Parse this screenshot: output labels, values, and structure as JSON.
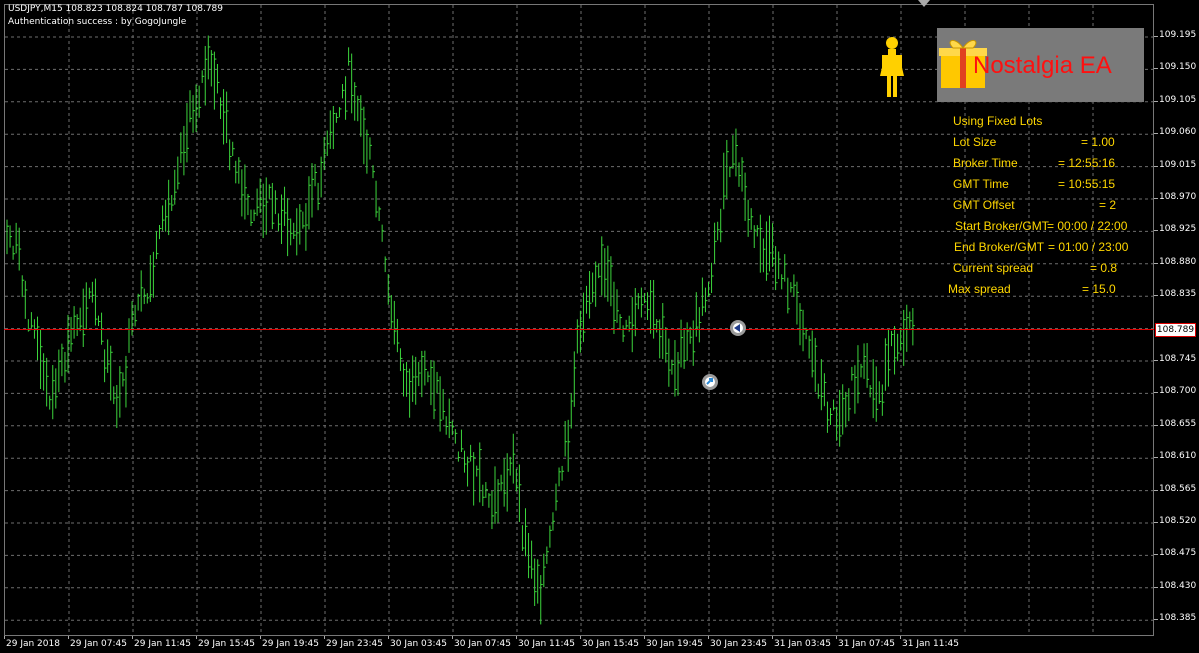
{
  "chart": {
    "symbol_info": "USDJPY,M15  108.823 108.824 108.787 108.789",
    "auth_text": "Authentication success : by GogoJungle",
    "current_price": "108.789",
    "y_axis_labels": [
      "109.195",
      "109.150",
      "109.105",
      "109.060",
      "109.015",
      "108.970",
      "108.925",
      "108.880",
      "108.835",
      "108.745",
      "108.700",
      "108.655",
      "108.610",
      "108.565",
      "108.520",
      "108.475",
      "108.430",
      "108.385"
    ],
    "x_axis_labels": [
      "29 Jan 2018",
      "29 Jan 07:45",
      "29 Jan 11:45",
      "29 Jan 15:45",
      "29 Jan 19:45",
      "29 Jan 23:45",
      "30 Jan 03:45",
      "30 Jan 07:45",
      "30 Jan 11:45",
      "30 Jan 15:45",
      "30 Jan 19:45",
      "30 Jan 23:45",
      "31 Jan 03:45",
      "31 Jan 07:45",
      "31 Jan 11:45"
    ],
    "colors": {
      "background": "#000000",
      "grid": "#6e6e6e",
      "bars": "#3cd53c",
      "price_line": "#e00000",
      "info_text": "#ffd700",
      "ea_title": "#ff1010"
    }
  },
  "ea_panel": {
    "title": "Nostalgia EA",
    "rows": [
      {
        "label": "Using Fixed Lots",
        "value": ""
      },
      {
        "label": "Lot Size",
        "value": "= 1.00"
      },
      {
        "label": "Broker Time",
        "value": "= 12:55:16"
      },
      {
        "label": "GMT Time",
        "value": "= 10:55:15"
      },
      {
        "label": "GMT Offset",
        "value": "= 2"
      },
      {
        "label": "Start Broker/GMT",
        "value": "= 00:00 / 22:00"
      },
      {
        "label": "End Broker/GMT",
        "value": "= 01:00 / 23:00"
      },
      {
        "label": "Current spread",
        "value": "= 0.8"
      },
      {
        "label": "Max spread",
        "value": "= 15.0"
      }
    ]
  }
}
